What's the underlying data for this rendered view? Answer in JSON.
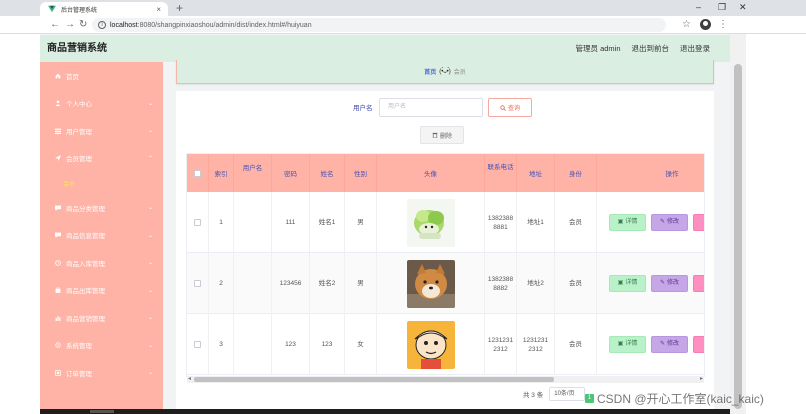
{
  "browser": {
    "tab_title": "后台管理系统",
    "url_host": "localhost",
    "url_path": ":8080/shangpinxiaoshou/admin/dist/index.html#/huiyuan",
    "icons": [
      "back-icon",
      "forward-icon",
      "reload-icon",
      "info-icon",
      "star-icon",
      "account-icon",
      "menu-icon"
    ]
  },
  "header": {
    "brand": "商品营销系统",
    "user": "管理员 admin",
    "front": "退出到前台",
    "logout": "退出登录"
  },
  "sidebar": {
    "items": [
      {
        "label": "首页",
        "icon": "home-icon"
      },
      {
        "label": "个人中心",
        "icon": "user-icon"
      },
      {
        "label": "用户管理",
        "icon": "list-icon"
      },
      {
        "label": "会员管理",
        "icon": "send-icon"
      },
      {
        "label": "会员",
        "sub": true
      },
      {
        "label": "商品分类管理",
        "icon": "chat-icon"
      },
      {
        "label": "商品信息管理",
        "icon": "chat-icon"
      },
      {
        "label": "商品入库管理",
        "icon": "clock-icon"
      },
      {
        "label": "商品出库管理",
        "icon": "bag-icon"
      },
      {
        "label": "商品营销管理",
        "icon": "chart-icon"
      },
      {
        "label": "系统管理",
        "icon": "gear-icon"
      },
      {
        "label": "订单管理",
        "icon": "doc-icon"
      }
    ]
  },
  "breadcrumb": {
    "home": "首页",
    "face": "(•̀ᴗ•́)",
    "current": "会员"
  },
  "search": {
    "label": "用户名",
    "placeholder": "用户名",
    "button": "查询"
  },
  "toolbar": {
    "delete": "删除"
  },
  "table": {
    "headers": [
      "索引",
      "用户名",
      "密码",
      "姓名",
      "性别",
      "头像",
      "联系电话",
      "地址",
      "身份",
      "操作"
    ],
    "rows": [
      {
        "index": "1",
        "username": "",
        "password": "111",
        "name": "姓名1",
        "gender": "男",
        "avatar": "cabbage-doll",
        "phone_a": "1382388",
        "phone_b": "8881",
        "address": "地址1",
        "role": "会员"
      },
      {
        "index": "2",
        "username": "",
        "password": "123456",
        "name": "姓名2",
        "gender": "男",
        "avatar": "shiba-dog",
        "phone_a": "1382388",
        "phone_b": "8882",
        "address": "地址2",
        "role": "会员"
      },
      {
        "index": "3",
        "username": "",
        "password": "123",
        "name": "123",
        "gender": "女",
        "avatar": "cartoon-boy",
        "phone_a": "1231231",
        "phone_b": "2312",
        "address_a": "1231231",
        "address_b": "2312",
        "role": "会员"
      }
    ],
    "actions": {
      "detail": "详情",
      "edit": "修改"
    }
  },
  "pager": {
    "total": "共 3 条",
    "size": "10条/页",
    "current": "1"
  },
  "watermark": "CSDN @开心工作室(kaic_kaic)",
  "colors": {
    "header_bg": "#dbeee2",
    "sidebar_bg": "#ffb2a6",
    "table_head_bg": "#ffb2a6",
    "detail_btn": "#b9f2c8",
    "edit_btn": "#c5a7e8",
    "delete_btn": "#ff8fc1"
  }
}
